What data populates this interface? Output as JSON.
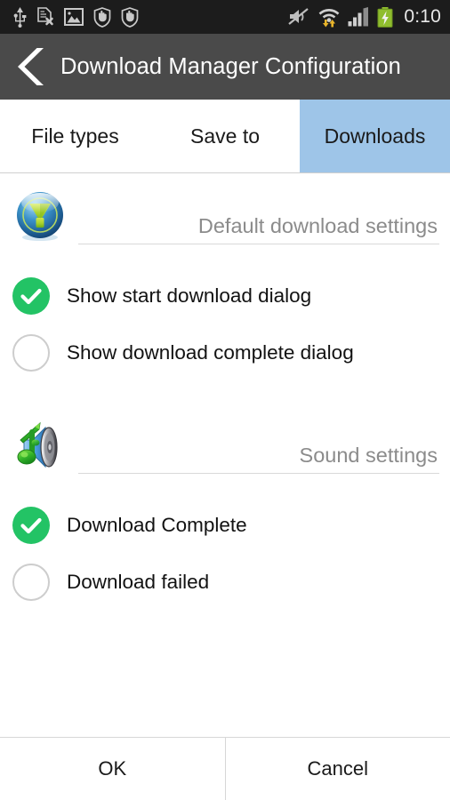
{
  "statusbar": {
    "icons_left": [
      "usb-icon",
      "document-error-icon",
      "image-icon",
      "shield-hand-icon",
      "shield-hand-icon"
    ],
    "icons_right": [
      "mute-icon",
      "wifi-transfer-icon",
      "signal-bars-icon",
      "battery-charging-icon"
    ],
    "clock": "0:10"
  },
  "titlebar": {
    "back_icon": "back-chevron-icon",
    "title": "Download Manager Configuration"
  },
  "tabs": [
    {
      "label": "File types",
      "selected": false
    },
    {
      "label": "Save to",
      "selected": false
    },
    {
      "label": "Downloads",
      "selected": true
    }
  ],
  "sections": [
    {
      "icon": "download-orb-icon",
      "label": "Default download settings",
      "options": [
        {
          "label": "Show start download dialog",
          "checked": true
        },
        {
          "label": "Show download complete dialog",
          "checked": false
        }
      ]
    },
    {
      "icon": "sound-speaker-note-icon",
      "label": "Sound settings",
      "options": [
        {
          "label": "Download Complete",
          "checked": true
        },
        {
          "label": "Download failed",
          "checked": false
        }
      ]
    }
  ],
  "buttons": {
    "ok": "OK",
    "cancel": "Cancel"
  },
  "colors": {
    "statusbar_bg": "#1c1c1c",
    "titlebar_bg": "#4a4a4a",
    "tab_selected_bg": "#9ec5e8",
    "checkbox_on": "#23c365",
    "checkbox_off_border": "#cdcdcd",
    "section_label": "#8b8b8b"
  }
}
